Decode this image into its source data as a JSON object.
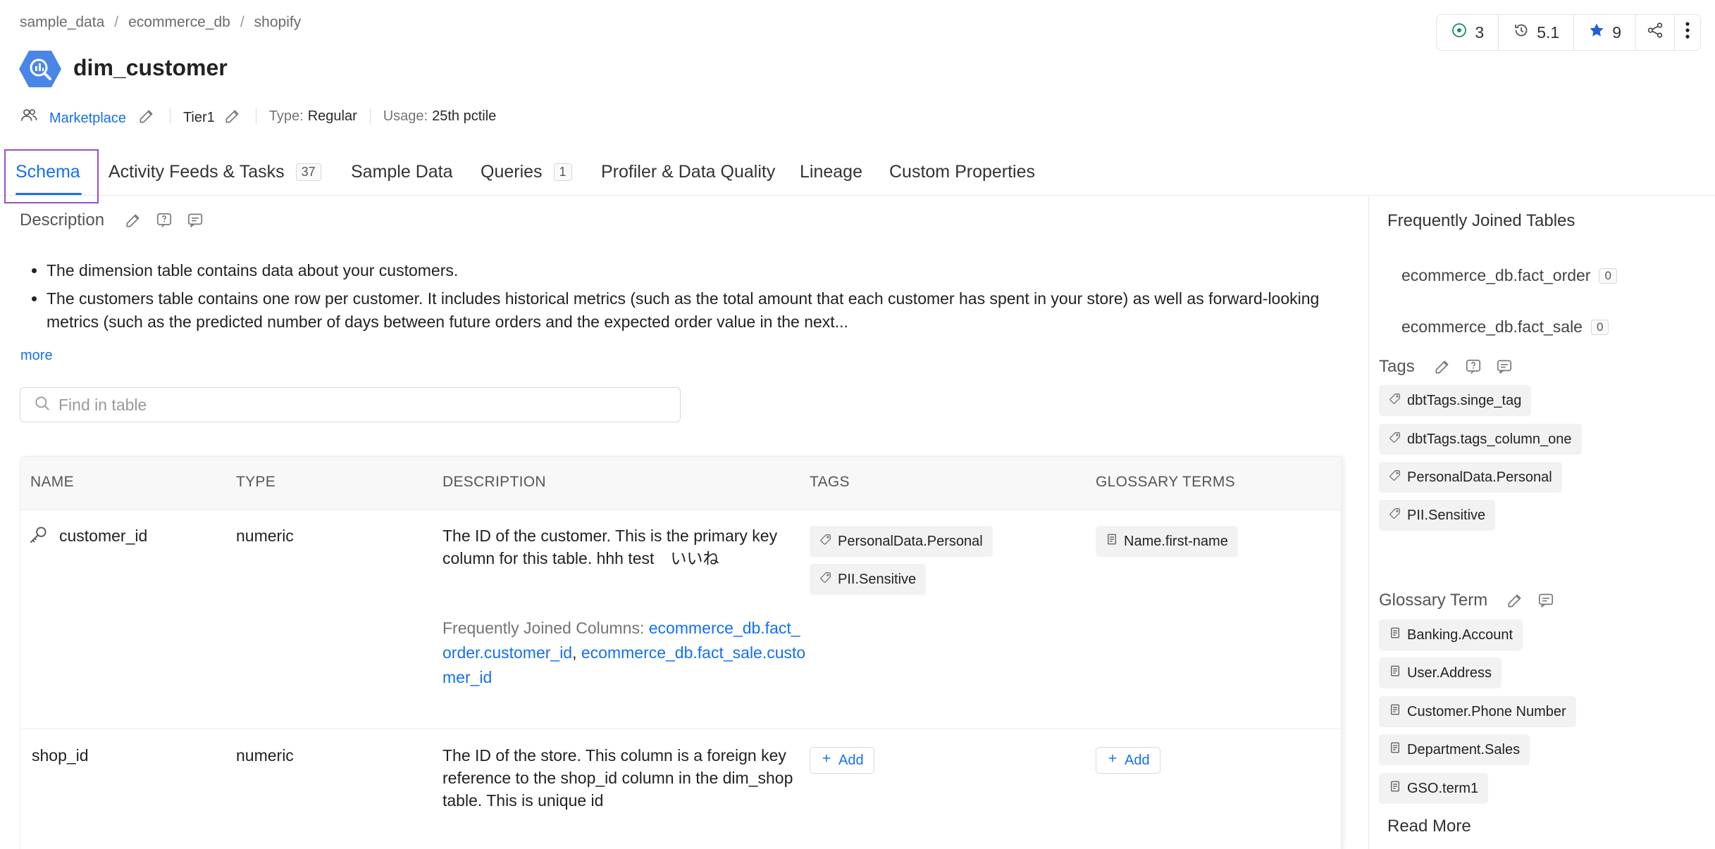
{
  "breadcrumb": [
    "sample_data",
    "ecommerce_db",
    "shopify"
  ],
  "breadcrumb_sep": "/",
  "title": "dim_customer",
  "owner": "Marketplace",
  "tier": "Tier1",
  "type_label": "Type:",
  "type_value": "Regular",
  "usage_label": "Usage:",
  "usage_value": "25th pctile",
  "stats": {
    "tasks": "3",
    "version": "5.1",
    "followers": "9"
  },
  "tabs": [
    {
      "label": "Schema",
      "active": true
    },
    {
      "label": "Activity Feeds & Tasks",
      "count": "37"
    },
    {
      "label": "Sample Data"
    },
    {
      "label": "Queries",
      "count": "1"
    },
    {
      "label": "Profiler & Data Quality"
    },
    {
      "label": "Lineage"
    },
    {
      "label": "Custom Properties"
    }
  ],
  "description": {
    "heading": "Description",
    "items": [
      "The dimension table contains data about your customers.",
      "The customers table contains one row per customer. It includes historical metrics (such as the total amount that each customer has spent in your store) as well as forward-looking metrics (such as the predicted number of days between future orders and the expected order value in the next..."
    ],
    "more": "more"
  },
  "search": {
    "placeholder": "Find in table"
  },
  "table": {
    "headers": [
      "NAME",
      "TYPE",
      "DESCRIPTION",
      "TAGS",
      "GLOSSARY TERMS"
    ],
    "rows": [
      {
        "name": "customer_id",
        "type": "numeric",
        "description": "The ID of the customer. This is the primary key column for this table. hhh test　いいね",
        "joined_label": "Frequently Joined Columns:",
        "joined_1": "ecommerce_db.fact_order.customer_id",
        "joined_sep": ",",
        "joined_2": "ecommerce_db.fact_sale.customer_id",
        "tags": [
          "PersonalData.Personal",
          "PII.Sensitive"
        ],
        "glossary": [
          "Name.first-name"
        ]
      },
      {
        "name": "shop_id",
        "type": "numeric",
        "description": "The ID of the store. This column is a foreign key reference to the shop_id column in the dim_shop table. This is unique id",
        "add_tag": "Add",
        "add_glossary": "Add"
      }
    ]
  },
  "right_panel": {
    "joined_title": "Frequently Joined Tables",
    "joined_tables": [
      {
        "name": "ecommerce_db.fact_order",
        "count": "0"
      },
      {
        "name": "ecommerce_db.fact_sale",
        "count": "0"
      }
    ],
    "tags_heading": "Tags",
    "tags": [
      "dbtTags.singe_tag",
      "dbtTags.tags_column_one",
      "PersonalData.Personal",
      "PII.Sensitive"
    ],
    "glossary_heading": "Glossary Term",
    "glossary": [
      "Banking.Account",
      "User.Address",
      "Customer.Phone Number",
      "Department.Sales",
      "GSO.term1"
    ],
    "read_more": "Read More"
  },
  "colors": {
    "accent": "#1570ef",
    "focus_outline": "#9a4fc6",
    "star": "#1f5fd6",
    "task_icon": "#1a8a6e"
  },
  "icons": [
    "bigquery-logo",
    "users-icon",
    "edit-icon",
    "task-icon",
    "history-icon",
    "star-icon",
    "share-icon",
    "more-vertical-icon",
    "request-icon",
    "conversation-icon",
    "search-icon",
    "key-icon",
    "tag-icon",
    "glossary-icon",
    "plus-icon"
  ]
}
